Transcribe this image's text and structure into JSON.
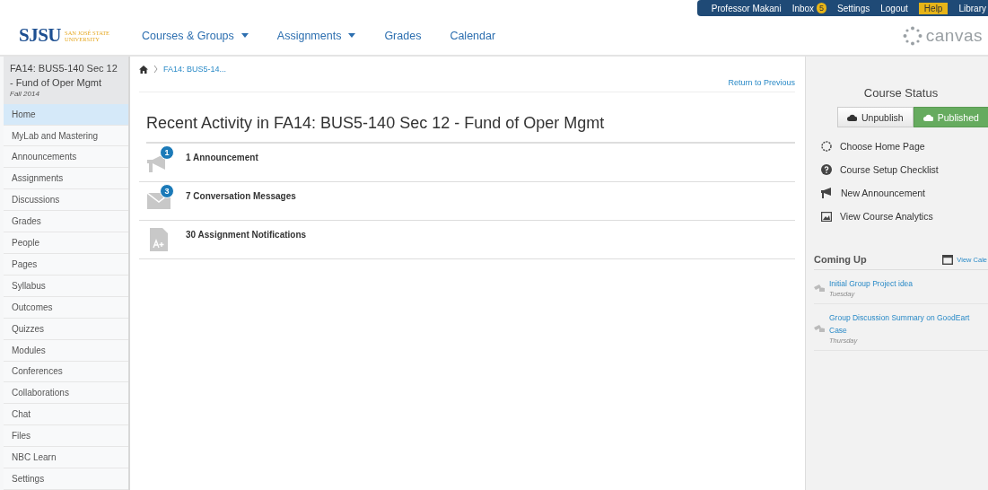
{
  "top_bar": {
    "user": "Professor Makani",
    "inbox": {
      "label": "Inbox",
      "count": "5"
    },
    "links": [
      {
        "label": "Settings",
        "highlighted": false
      },
      {
        "label": "Logout",
        "highlighted": false
      },
      {
        "label": "Help",
        "highlighted": true
      },
      {
        "label": "Library",
        "highlighted": false
      }
    ]
  },
  "logo": {
    "mark": "SJSU",
    "line1": "SAN JOSÉ STATE",
    "line2": "UNIVERSITY"
  },
  "brand": "canvas",
  "nav": [
    {
      "label": "Courses & Groups",
      "dropdown": true
    },
    {
      "label": "Assignments",
      "dropdown": true
    },
    {
      "label": "Grades",
      "dropdown": false
    },
    {
      "label": "Calendar",
      "dropdown": false
    }
  ],
  "course": {
    "title": "FA14: BUS5-140 Sec 12 - Fund of Oper Mgmt",
    "term": "Fall 2014"
  },
  "sidebar": {
    "items": [
      {
        "label": "Home",
        "selected": true
      },
      {
        "label": "MyLab and Mastering",
        "selected": false
      },
      {
        "label": "Announcements",
        "selected": false
      },
      {
        "label": "Assignments",
        "selected": false
      },
      {
        "label": "Discussions",
        "selected": false
      },
      {
        "label": "Grades",
        "selected": false
      },
      {
        "label": "People",
        "selected": false
      },
      {
        "label": "Pages",
        "selected": false
      },
      {
        "label": "Syllabus",
        "selected": false
      },
      {
        "label": "Outcomes",
        "selected": false
      },
      {
        "label": "Quizzes",
        "selected": false
      },
      {
        "label": "Modules",
        "selected": false
      },
      {
        "label": "Conferences",
        "selected": false
      },
      {
        "label": "Collaborations",
        "selected": false
      },
      {
        "label": "Chat",
        "selected": false
      },
      {
        "label": "Files",
        "selected": false
      },
      {
        "label": "NBC Learn",
        "selected": false
      },
      {
        "label": "Settings",
        "selected": false
      }
    ]
  },
  "breadcrumb": "FA14: BUS5-14...",
  "return_link": "Return to Previous",
  "heading": "Recent Activity in FA14: BUS5-140 Sec 12 - Fund of Oper Mgmt",
  "activity": [
    {
      "kind": "announcement",
      "badge": "1",
      "label": "1 Announcement"
    },
    {
      "kind": "message",
      "badge": "3",
      "label": "7 Conversation Messages"
    },
    {
      "kind": "assignment",
      "label": "30 Assignment Notifications"
    }
  ],
  "course_status": {
    "title": "Course Status",
    "buttons": [
      {
        "label": "Unpublish",
        "selected": false
      },
      {
        "label": "Published",
        "selected": true
      }
    ]
  },
  "actions": [
    {
      "kind": "home",
      "label": "Choose Home Page"
    },
    {
      "kind": "help",
      "label": "Course Setup Checklist"
    },
    {
      "kind": "announcement",
      "label": "New Announcement"
    },
    {
      "kind": "analytics",
      "label": "View Course Analytics"
    }
  ],
  "coming_up": {
    "title": "Coming Up",
    "link": "View Cale",
    "items": [
      {
        "title": "Initial Group Project idea",
        "day": "Tuesday"
      },
      {
        "title": "Group Discussion Summary on GoodEart\nCase",
        "day": "Thursday"
      }
    ]
  }
}
